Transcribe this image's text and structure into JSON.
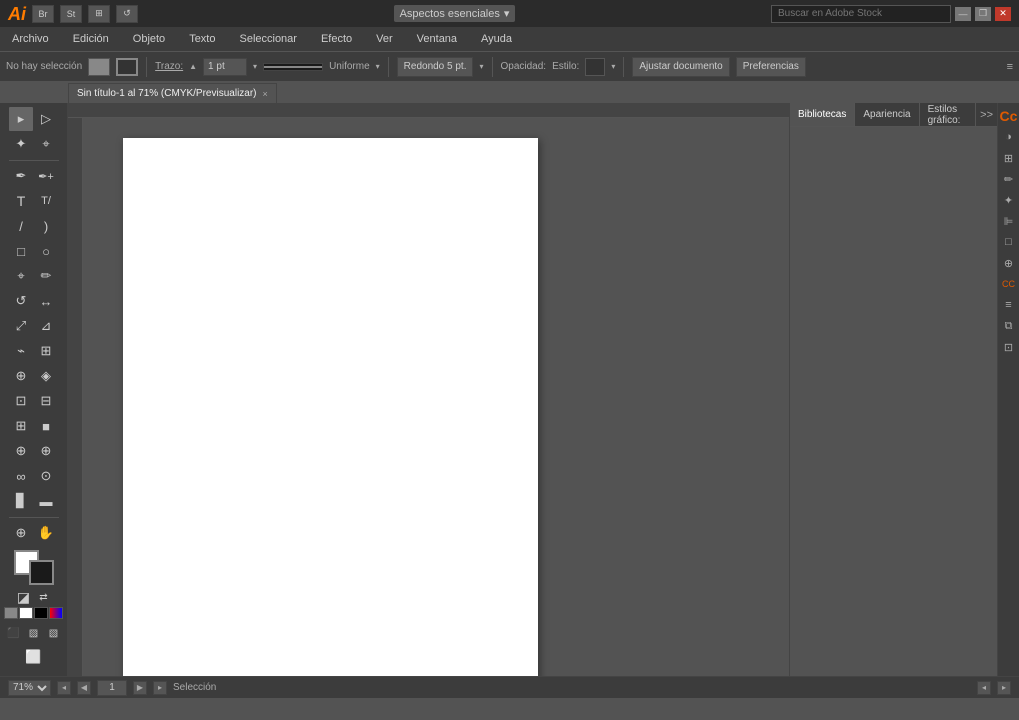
{
  "app": {
    "logo": "Ai",
    "title": "Adobe Illustrator"
  },
  "titlebar": {
    "workspace": "Aspectos esenciales",
    "search_placeholder": "Buscar en Adobe Stock",
    "minimize": "—",
    "maximize": "❒",
    "close": "✕"
  },
  "menubar": {
    "items": [
      "Archivo",
      "Edición",
      "Objeto",
      "Texto",
      "Seleccionar",
      "Efecto",
      "Ver",
      "Ventana",
      "Ayuda"
    ]
  },
  "toolbar": {
    "no_selection": "No hay selección",
    "trazo_label": "Trazo:",
    "trazo_value": "1 pt",
    "stroke_type": "Uniforme",
    "redondo_label": "Redondo 5 pt.",
    "opacidad_label": "Opacidad:",
    "estilo_label": "Estilo:",
    "ajustar_btn": "Ajustar documento",
    "preferencias_btn": "Preferencias"
  },
  "tab": {
    "title": "Sin título-1 al 71% (CMYK/Previsualizar)",
    "close": "×"
  },
  "panels": {
    "bibliotecas": "Bibliotecas",
    "apariencia": "Apariencia",
    "estilos": "Estilos gráfico:",
    "expand": ">>"
  },
  "statusbar": {
    "zoom": "71%",
    "selection_label": "Selección",
    "page": "1"
  },
  "tools": {
    "selection": "▸",
    "direct_selection": "▷",
    "lasso": "⌗",
    "pen": "✒",
    "type": "T",
    "line": "/",
    "rect": "□",
    "rotate": "↺",
    "reflect": "↔",
    "scale": "⤡",
    "mesh": "⊞",
    "gradient": "■",
    "eyedropper": "⊕",
    "blend": "∞",
    "symbol": "⊙",
    "column": "▊",
    "zoom": "⊕",
    "hand": "✋"
  }
}
